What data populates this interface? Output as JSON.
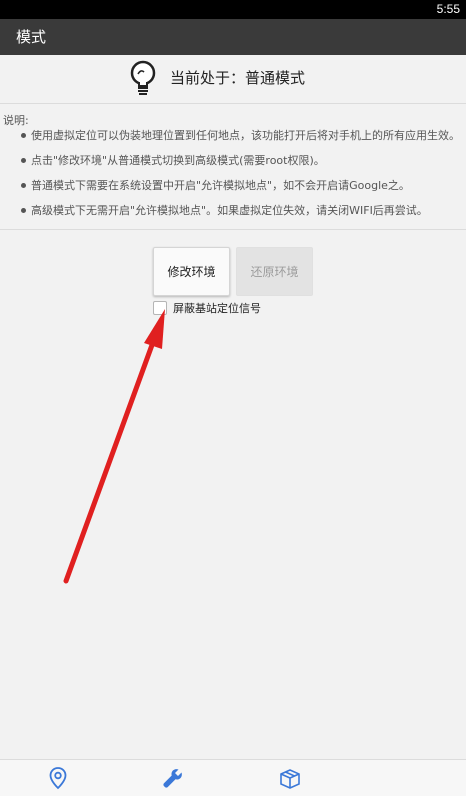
{
  "status": {
    "time": "5:55"
  },
  "app_bar": {
    "title": "模式"
  },
  "mode": {
    "text": "当前处于：普通模式"
  },
  "instructions": {
    "label": "说明:",
    "items": [
      "使用虚拟定位可以伪装地理位置到任何地点，该功能打开后将对手机上的所有应用生效。",
      "点击\"修改环境\"从普通模式切换到高级模式(需要root权限)。",
      "普通模式下需要在系统设置中开启\"允许模拟地点\"，如不会开启请Google之。",
      "高级模式下无需开启\"允许模拟地点\"。如果虚拟定位失效，请关闭WIFI后再尝试。"
    ]
  },
  "buttons": {
    "modify": "修改环境",
    "restore": "还原环境"
  },
  "checkbox": {
    "label": "屏蔽基站定位信号",
    "checked": false
  },
  "bottom_nav": {
    "items": [
      "location-pin-icon",
      "wrench-icon",
      "box-icon"
    ],
    "active_color": "#3b78d8",
    "inactive_color": "#3b78d8"
  },
  "colors": {
    "app_bar": "#3a3a3a",
    "annotation_arrow": "#e02020"
  }
}
